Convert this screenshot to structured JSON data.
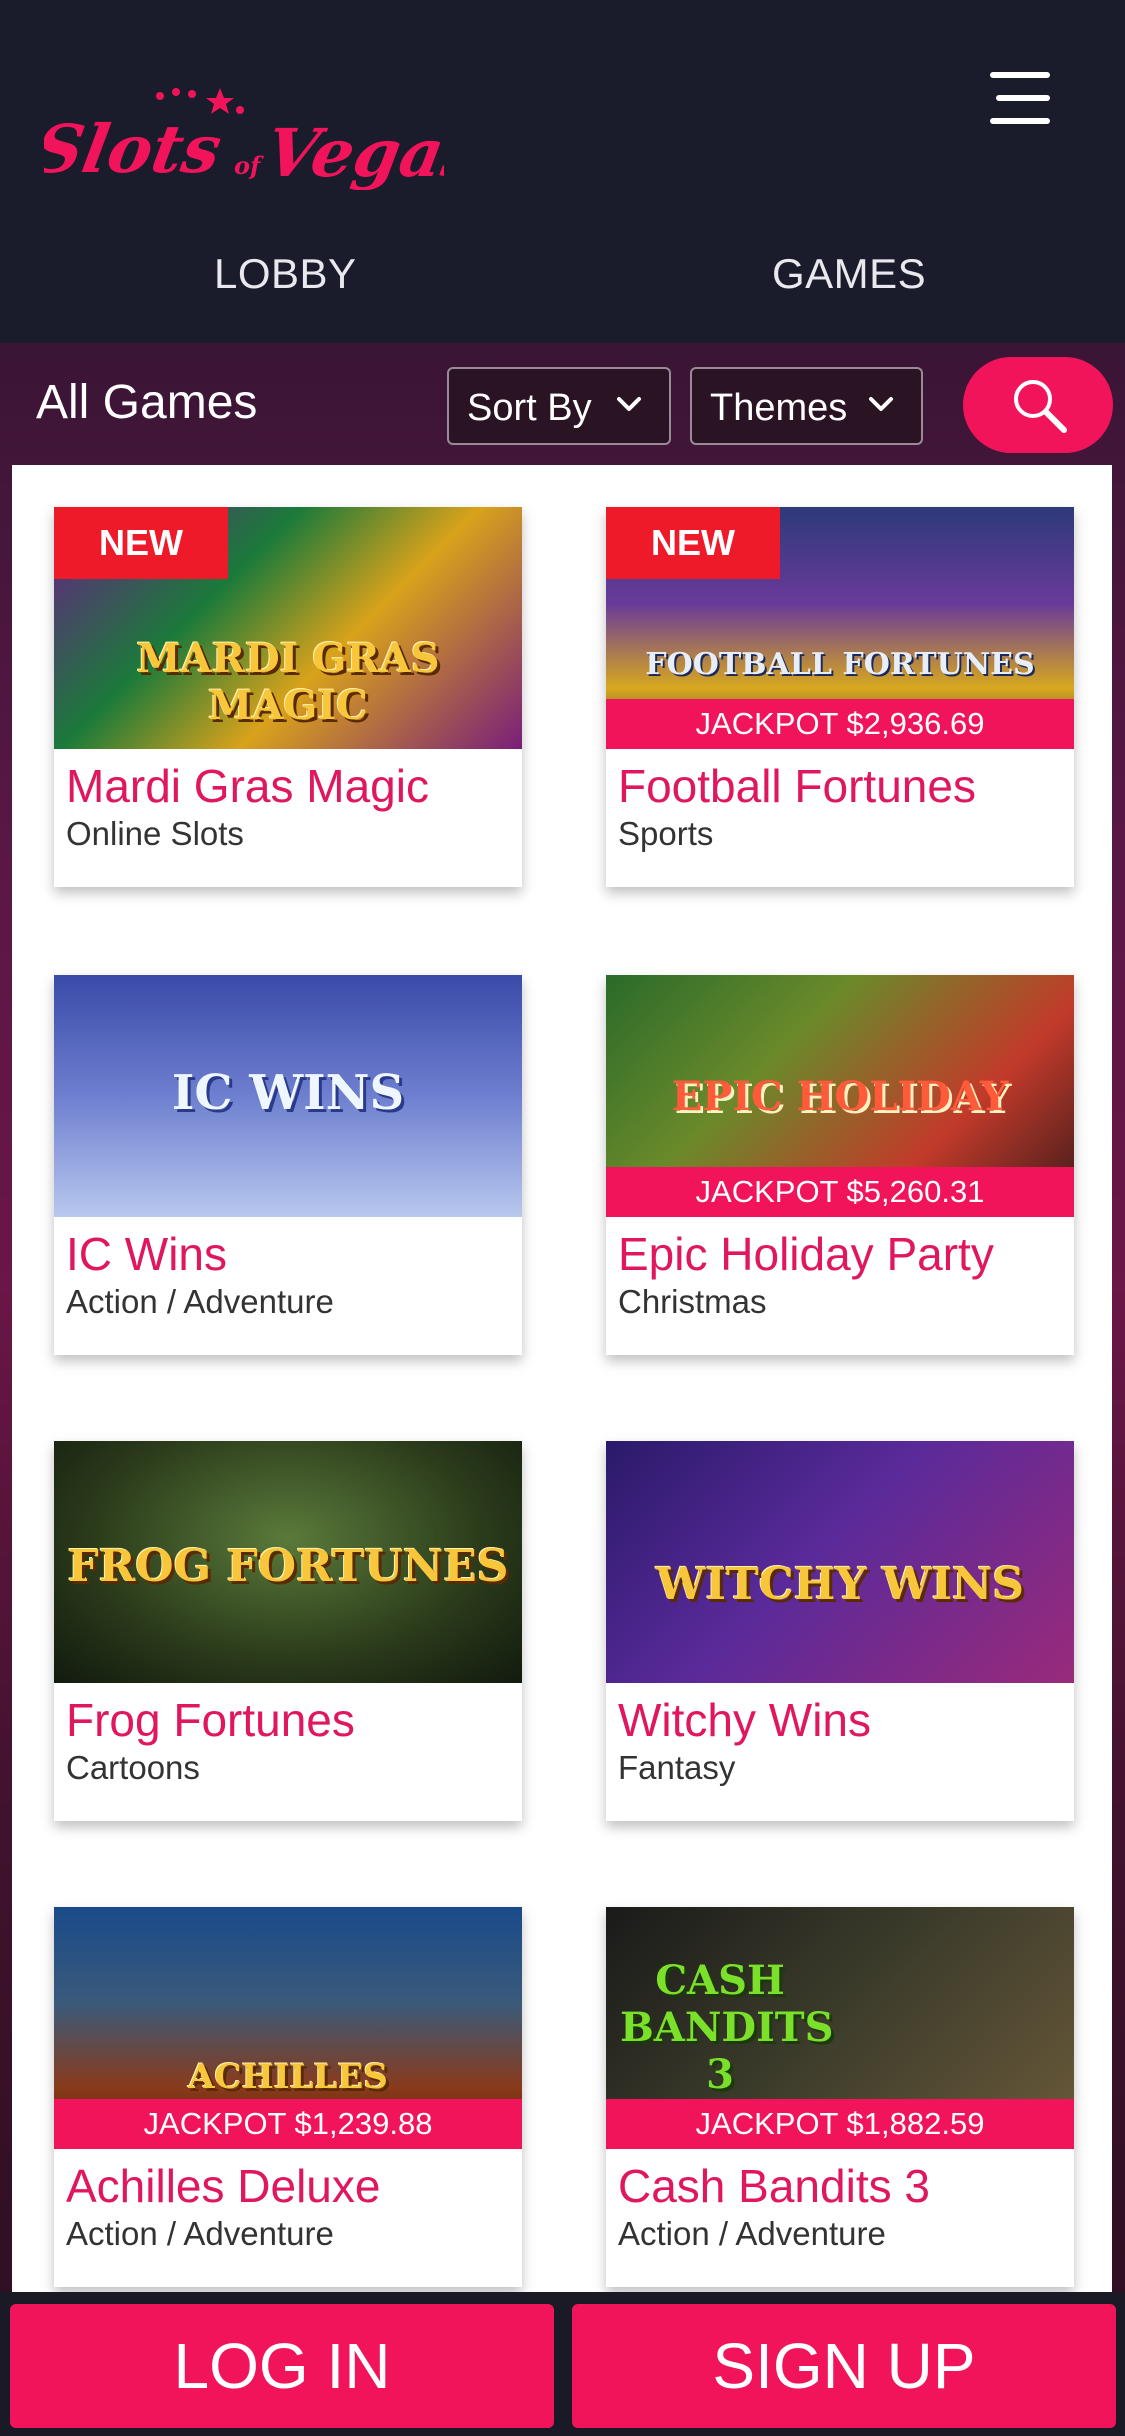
{
  "header": {
    "logo_text": "Slots of Vegas",
    "nav": {
      "lobby": "LOBBY",
      "games": "GAMES"
    }
  },
  "toolbar": {
    "title": "All Games",
    "sort_label": "Sort By",
    "themes_label": "Themes"
  },
  "badges": {
    "new": "NEW"
  },
  "games": [
    {
      "title": "Mardi Gras Magic",
      "category": "Online Slots",
      "new": true,
      "jackpot": "",
      "art_text": "MARDI GRAS MAGIC"
    },
    {
      "title": "Football Fortunes",
      "category": "Sports",
      "new": true,
      "jackpot": "JACKPOT $2,936.69",
      "art_text": "FOOTBALL FORTUNES"
    },
    {
      "title": "IC Wins",
      "category": "Action / Adventure",
      "new": false,
      "jackpot": "",
      "art_text": "IC WINS"
    },
    {
      "title": "Epic Holiday Party",
      "category": "Christmas",
      "new": false,
      "jackpot": "JACKPOT $5,260.31",
      "art_text": "EPIC HOLIDAY"
    },
    {
      "title": "Frog Fortunes",
      "category": "Cartoons",
      "new": false,
      "jackpot": "",
      "art_text": "FROG FORTUNES"
    },
    {
      "title": "Witchy Wins",
      "category": "Fantasy",
      "new": false,
      "jackpot": "",
      "art_text": "WITCHY WINS"
    },
    {
      "title": "Achilles Deluxe",
      "category": "Action / Adventure",
      "new": false,
      "jackpot": "JACKPOT $1,239.88",
      "art_text": "ACHILLES"
    },
    {
      "title": "Cash Bandits 3",
      "category": "Action / Adventure",
      "new": false,
      "jackpot": "JACKPOT $1,882.59",
      "art_text": "CASH BANDITS 3"
    }
  ],
  "footer": {
    "login": "LOG IN",
    "signup": "SIGN UP"
  },
  "colors": {
    "accent": "#f2145a",
    "header_bg": "#1a1b2b",
    "new_badge": "#ee1a2a"
  }
}
